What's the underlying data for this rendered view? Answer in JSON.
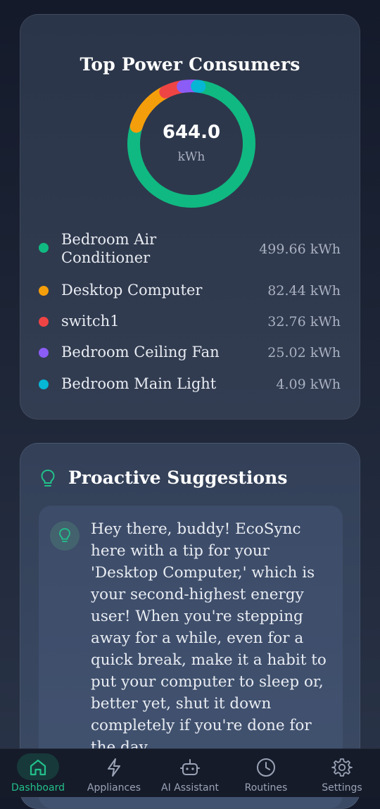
{
  "consumers": {
    "title": "Top Power Consumers",
    "total": "644.0",
    "unit": "kWh",
    "items": [
      {
        "name": "Bedroom Air Conditioner",
        "value": "499.66 kWh",
        "kwh": 499.66,
        "color": "#10b981"
      },
      {
        "name": "Desktop Computer",
        "value": "82.44 kWh",
        "kwh": 82.44,
        "color": "#f59e0b"
      },
      {
        "name": "switch1",
        "value": "32.76 kWh",
        "kwh": 32.76,
        "color": "#ef4444"
      },
      {
        "name": "Bedroom Ceiling Fan",
        "value": "25.02 kWh",
        "kwh": 25.02,
        "color": "#8b5cf6"
      },
      {
        "name": "Bedroom Main Light",
        "value": "4.09 kWh",
        "kwh": 4.09,
        "color": "#06b6d4"
      }
    ]
  },
  "suggestions": {
    "title": "Proactive Suggestions",
    "tip": "Hey there, buddy! EcoSync here with a tip for your 'Desktop Computer,' which is your second-highest energy user! When you're stepping away for a while, even for a quick break, make it a habit to put your computer to sleep or, better yet, shut it down completely if you're done for the day."
  },
  "nav": {
    "active": "dashboard",
    "items": [
      {
        "id": "dashboard",
        "label": "Dashboard",
        "icon": "home-icon"
      },
      {
        "id": "appliances",
        "label": "Appliances",
        "icon": "lightning-icon"
      },
      {
        "id": "ai-assistant",
        "label": "AI Assistant",
        "icon": "robot-icon"
      },
      {
        "id": "routines",
        "label": "Routines",
        "icon": "clock-icon"
      },
      {
        "id": "settings",
        "label": "Settings",
        "icon": "gear-icon"
      }
    ]
  },
  "colors": {
    "accent": "#22c08a",
    "nav_inactive": "#9aa3b5"
  }
}
